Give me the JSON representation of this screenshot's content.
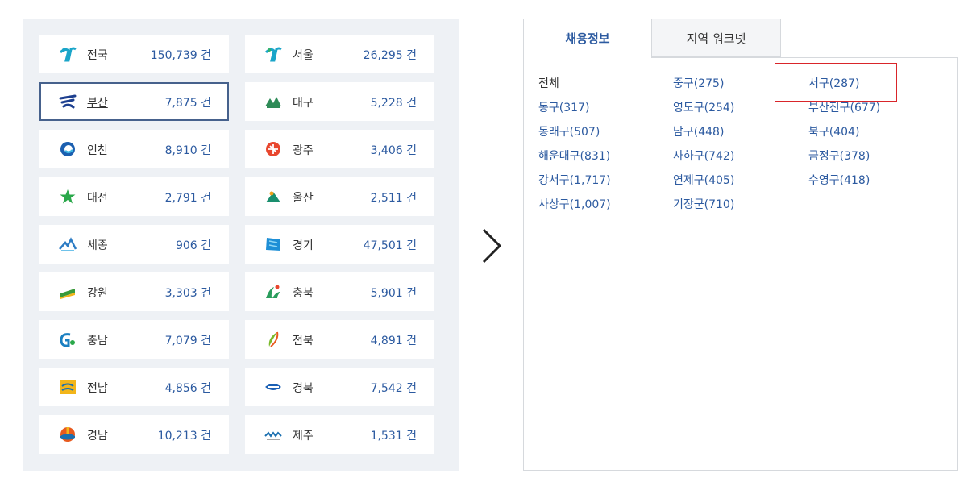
{
  "regions": [
    {
      "name": "전국",
      "count": "150,739 건",
      "icon": "korea-emblem-icon",
      "color": "#1aa5c9"
    },
    {
      "name": "서울",
      "count": "26,295 건",
      "icon": "seoul-emblem-icon",
      "color": "#1aa5c9"
    },
    {
      "name": "부산",
      "count": "7,875 건",
      "icon": "busan-emblem-icon",
      "color": "#1d3f8f",
      "selected": true
    },
    {
      "name": "대구",
      "count": "5,228 건",
      "icon": "daegu-emblem-icon",
      "color": "#2e8b57"
    },
    {
      "name": "인천",
      "count": "8,910 건",
      "icon": "incheon-emblem-icon",
      "color": "#1b5fb0"
    },
    {
      "name": "광주",
      "count": "3,406 건",
      "icon": "gwangju-emblem-icon",
      "color": "#e8462e"
    },
    {
      "name": "대전",
      "count": "2,791 건",
      "icon": "daejeon-emblem-icon",
      "color": "#2aa84a"
    },
    {
      "name": "울산",
      "count": "2,511 건",
      "icon": "ulsan-emblem-icon",
      "color": "#1a8f6e"
    },
    {
      "name": "세종",
      "count": "906 건",
      "icon": "sejong-emblem-icon",
      "color": "#2d7cc4"
    },
    {
      "name": "경기",
      "count": "47,501 건",
      "icon": "gyeonggi-emblem-icon",
      "color": "#1e8fd6"
    },
    {
      "name": "강원",
      "count": "3,303 건",
      "icon": "gangwon-emblem-icon",
      "color": "#3a9a3a"
    },
    {
      "name": "충북",
      "count": "5,901 건",
      "icon": "chungbuk-emblem-icon",
      "color": "#2a9d5c"
    },
    {
      "name": "충남",
      "count": "7,079 건",
      "icon": "chungnam-emblem-icon",
      "color": "#1a7fc1"
    },
    {
      "name": "전북",
      "count": "4,891 건",
      "icon": "jeonbuk-emblem-icon",
      "color": "#7ab929"
    },
    {
      "name": "전남",
      "count": "4,856 건",
      "icon": "jeonnam-emblem-icon",
      "color": "#f2b51a"
    },
    {
      "name": "경북",
      "count": "7,542 건",
      "icon": "gyeongbuk-emblem-icon",
      "color": "#1a5fb4"
    },
    {
      "name": "경남",
      "count": "10,213 건",
      "icon": "gyeongnam-emblem-icon",
      "color": "#e85a1e"
    },
    {
      "name": "제주",
      "count": "1,531 건",
      "icon": "jeju-emblem-icon",
      "color": "#1a6fb0"
    }
  ],
  "tabs": [
    {
      "label": "채용정보",
      "active": true
    },
    {
      "label": "지역 워크넷",
      "active": false
    }
  ],
  "districts": [
    "전체",
    "중구(275)",
    "서구(287)",
    "동구(317)",
    "영도구(254)",
    "부산진구(677)",
    "동래구(507)",
    "남구(448)",
    "북구(404)",
    "해운대구(831)",
    "사하구(742)",
    "금정구(378)",
    "강서구(1,717)",
    "연제구(405)",
    "수영구(418)",
    "사상구(1,007)",
    "기장군(710)"
  ],
  "highlighted_district": "서구(287)",
  "colors": {
    "accent": "#2c5aa0",
    "panel_bg": "#eef1f5",
    "selected_border": "#46618c",
    "highlight": "#d9252a"
  }
}
